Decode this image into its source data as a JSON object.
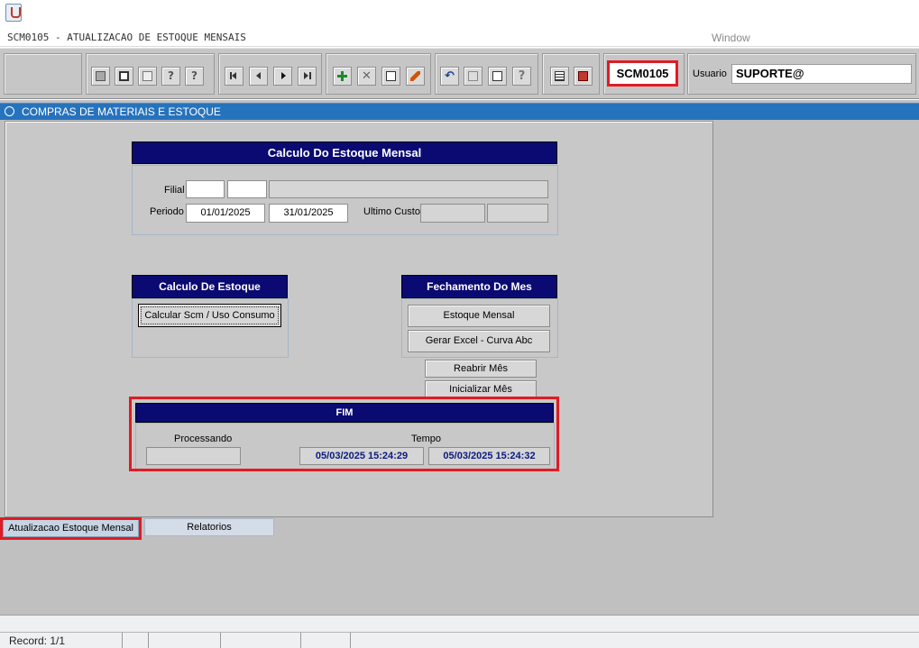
{
  "window": {
    "title": "SCM0105 - ATUALIZACAO DE ESTOQUE MENSAIS",
    "menu": "Window"
  },
  "toolbar": {
    "form_code": "SCM0105",
    "user_label": "Usuario",
    "user_value": "SUPORTE@"
  },
  "module": {
    "title": "COMPRAS DE MATERIAIS E ESTOQUE"
  },
  "calc_panel": {
    "title": "Calculo Do Estoque Mensal",
    "filial_label": "Filial",
    "periodo_label": "Periodo",
    "periodo_start": "01/01/2025",
    "periodo_end": "31/01/2025",
    "ultimo_custo_label": "Ultimo Custo"
  },
  "calculo_estoque": {
    "title": "Calculo De Estoque",
    "calcular_button": "Calcular Scm / Uso Consumo"
  },
  "fechamento": {
    "title": "Fechamento Do Mes",
    "estoque_mensal_button": "Estoque Mensal",
    "gerar_excel_button": "Gerar Excel - Curva Abc",
    "reabrir_button": "Reabrir Mês",
    "inicializar_button": "Inicializar Mês"
  },
  "fim": {
    "title": "FIM",
    "processando_label": "Processando",
    "tempo_label": "Tempo",
    "tempo_start": "05/03/2025 15:24:29",
    "tempo_end": "05/03/2025 15:24:32"
  },
  "tabs": [
    {
      "label": "Atualizacao Estoque Mensal",
      "active": true
    },
    {
      "label": "Relatorios",
      "active": false
    }
  ],
  "status": {
    "record": "Record: 1/1"
  },
  "colors": {
    "frame_title_bg": "#0a0a72",
    "module_bar": "#2673bd",
    "highlight": "#e01b24"
  }
}
